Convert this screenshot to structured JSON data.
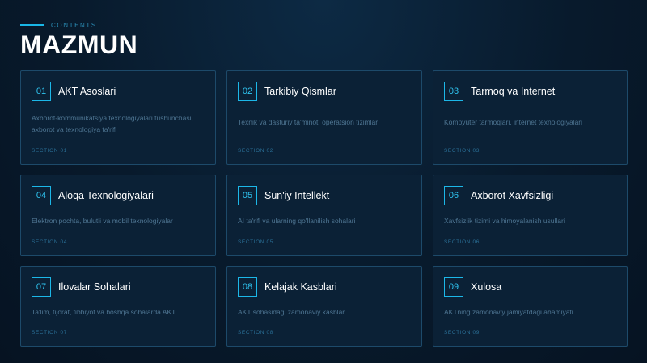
{
  "header": {
    "kicker": "CONTENTS",
    "title": "MAZMUN"
  },
  "cards": [
    {
      "num": "01",
      "title": "AKT Asoslari",
      "desc": "Axborot-kommunikatsiya texnologiyalari tushunchasi, axborot va texnologiya ta'rifi",
      "section": "SECTION 01"
    },
    {
      "num": "02",
      "title": "Tarkibiy Qismlar",
      "desc": "Texnik va dasturiy ta'minot, operatsion tizimlar",
      "section": "SECTION 02"
    },
    {
      "num": "03",
      "title": "Tarmoq va Internet",
      "desc": "Kompyuter tarmoqlari, internet texnologiyalari",
      "section": "SECTION 03"
    },
    {
      "num": "04",
      "title": "Aloqa Texnologiyalari",
      "desc": "Elektron pochta, bulutli va mobil texnologiyalar",
      "section": "SECTION 04"
    },
    {
      "num": "05",
      "title": "Sun'iy Intellekt",
      "desc": "AI ta'rifi va ularning qo'llanilish sohalari",
      "section": "SECTION 05"
    },
    {
      "num": "06",
      "title": "Axborot Xavfsizligi",
      "desc": "Xavfsizlik tizimi va himoyalanish usullari",
      "section": "SECTION 06"
    },
    {
      "num": "07",
      "title": "Ilovalar Sohalari",
      "desc": "Ta'lim, tijorat, tibbiyot va boshqa sohalarda AKT",
      "section": "SECTION 07"
    },
    {
      "num": "08",
      "title": "Kelajak Kasblari",
      "desc": "AKT sohasidagi zamonaviy kasblar",
      "section": "SECTION 08"
    },
    {
      "num": "09",
      "title": "Xulosa",
      "desc": "AKTning zamonaviy jamiyatdagi ahamiyati",
      "section": "SECTION 09"
    }
  ],
  "colors": {
    "accent": "#1cb7e8",
    "background": "#081a2c",
    "card": "#0b2136",
    "border": "#1d4a6a"
  }
}
